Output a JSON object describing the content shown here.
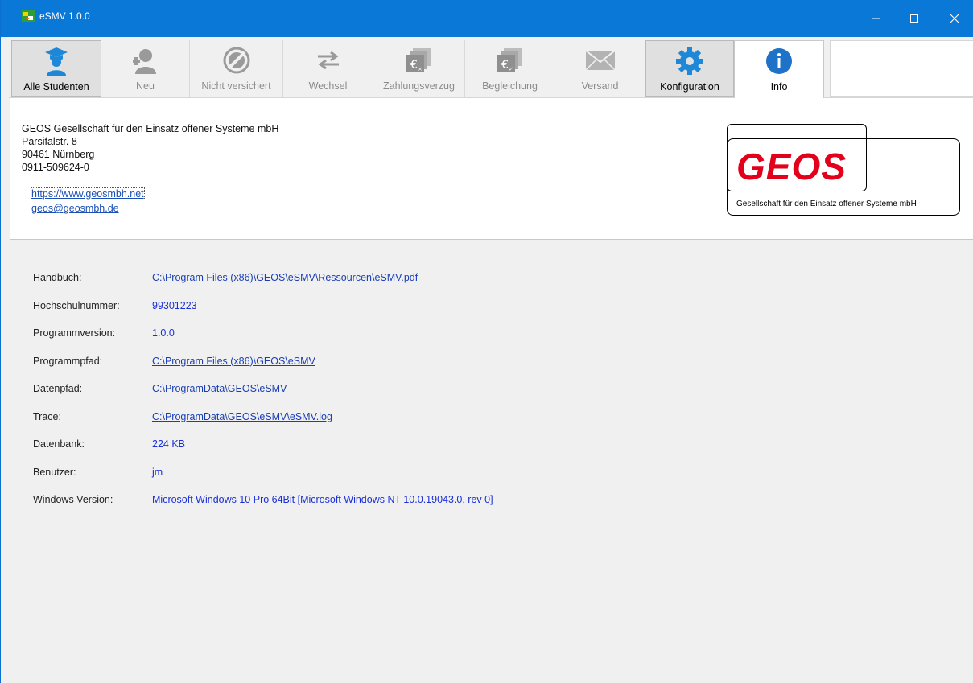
{
  "window": {
    "title": "eSMV 1.0.0",
    "accent": "#0a78d7",
    "minimize_label": "—",
    "maximize_label": "☐",
    "close_label": "✕"
  },
  "toolbar": {
    "items": [
      {
        "label": "Alle Studenten",
        "icon": "graduate-icon",
        "state": "active"
      },
      {
        "label": "Neu",
        "icon": "add-user-icon",
        "state": "disabled"
      },
      {
        "label": "Nicht versichert",
        "icon": "not-insured-icon",
        "state": "disabled"
      },
      {
        "label": "Wechsel",
        "icon": "swap-arrows-icon",
        "state": "disabled"
      },
      {
        "label": "Zahlungsverzug",
        "icon": "payment-overdue-icon",
        "state": "disabled"
      },
      {
        "label": "Begleichung",
        "icon": "payment-settled-icon",
        "state": "disabled"
      },
      {
        "label": "Versand",
        "icon": "envelope-icon",
        "state": "disabled"
      },
      {
        "label": "Konfiguration",
        "icon": "gear-icon",
        "state": "active"
      },
      {
        "label": "Info",
        "icon": "info-icon",
        "state": "selected"
      }
    ]
  },
  "company": {
    "name": "GEOS Gesellschaft für den Einsatz offener Systeme mbH",
    "street": "Parsifalstr. 8",
    "city": "90461 Nürnberg",
    "phone": "0911-509624-0",
    "website": "https://www.geosmbh.net",
    "email": "geos@geosmbh.de"
  },
  "logo": {
    "brand": "GEOS",
    "tagline": "Gesellschaft für den Einsatz offener Systeme mbH",
    "brand_color": "#e3001b"
  },
  "details": [
    {
      "key": "Handbuch:",
      "value": "C:\\Program Files (x86)\\GEOS\\eSMV\\Ressourcen\\eSMV.pdf",
      "link": true
    },
    {
      "key": "Hochschulnummer:",
      "value": "99301223",
      "link": false
    },
    {
      "key": "Programmversion:",
      "value": "1.0.0",
      "link": false
    },
    {
      "key": "Programmpfad:",
      "value": "C:\\Program Files (x86)\\GEOS\\eSMV",
      "link": true
    },
    {
      "key": "Datenpfad:",
      "value": "C:\\ProgramData\\GEOS\\eSMV",
      "link": true
    },
    {
      "key": "Trace:",
      "value": "C:\\ProgramData\\GEOS\\eSMV\\eSMV.log",
      "link": true
    },
    {
      "key": "Datenbank:",
      "value": "224 KB",
      "link": false
    },
    {
      "key": "Benutzer:",
      "value": "jm",
      "link": false
    },
    {
      "key": "Windows Version:",
      "value": "Microsoft Windows 10 Pro 64Bit [Microsoft Windows NT 10.0.19043.0, rev 0]",
      "link": false
    }
  ]
}
